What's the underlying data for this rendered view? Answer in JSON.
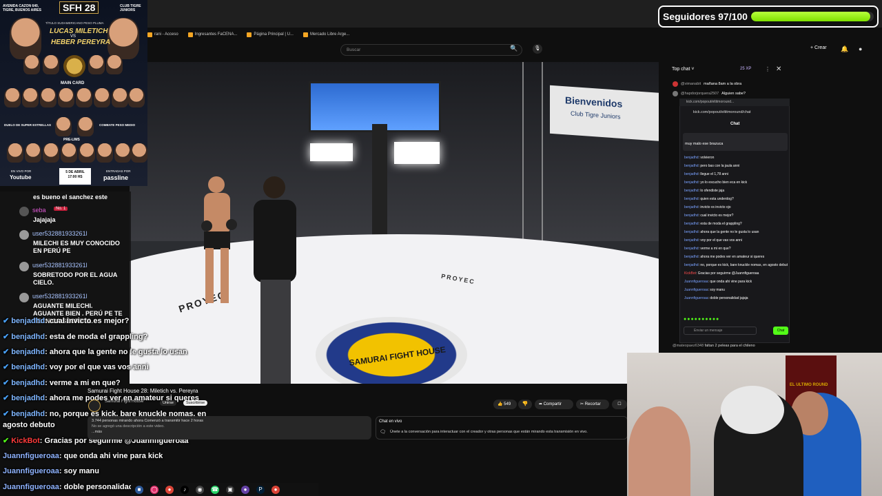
{
  "bookmarks": [
    "rani - Acceso",
    "Ingresantes FaCENA...",
    "Página Principal | U...",
    "Mercado Libre Arge..."
  ],
  "yt_header": {
    "search_placeholder": "Buscar",
    "create_label": "Crear"
  },
  "video": {
    "banner_title": "Bienvenidos",
    "banner_subtitle": "Club Tigre Juniors",
    "floor_brand_right": "PROYEC",
    "floor_brand_left": "PROYEC",
    "center_logo": "SAMURAI FIGHT HOUSE"
  },
  "poster": {
    "left_text": "AVENIDA CAZON 640, TIGRE, BUENOS AIRES",
    "right_text": "CLUB TIGRE JUNIORS",
    "event": "SFH 28",
    "title_line": "TÍTULO SUDAMERICANO PESO PLUMA",
    "fighter1": "LUCAS MILETICH",
    "vs": "VS",
    "fighter2": "HEBER PEREYRA",
    "main_card": "MAIN CARD",
    "duelo": "DUELO DE SUPER ESTRELLAS",
    "combate": "COMBATE PESO MEDIO",
    "prelims": "PRE-LIMS",
    "en_vivo": "EN VIVO POR",
    "youtube": "Youtube",
    "date": "5 DE ABRIL",
    "time": "17:00 HS",
    "entradas": "ENTRADAS POR",
    "passline": "passline"
  },
  "left_chat": [
    {
      "name": "",
      "msg": "es bueno el sanchez este"
    },
    {
      "name": "seba",
      "badge": "No. 1",
      "msg": "Jajajaja"
    },
    {
      "name": "user532881933261l",
      "msg": "MILECHI ES MUY CONOCIDO EN PERÚ PE"
    },
    {
      "name": "user532881933261l",
      "msg": "SOBRETODO POR EL AGUA CIELO."
    },
    {
      "name": "user532881933261l",
      "msg": "AGUANTE MILECHI. AGUANTE BIEN . PERÚ PE TE TECNICA SECRETA."
    }
  ],
  "overlay_chat": [
    {
      "user": "benjadhd",
      "text": "cual invicto es mejor?"
    },
    {
      "user": "benjadhd",
      "text": "esta de moda el grappling?"
    },
    {
      "user": "benjadhd",
      "text": "ahora que la gente no le gusta lo usan"
    },
    {
      "user": "benjadhd",
      "text": "voy por el que vas vos anni"
    },
    {
      "user": "benjadhd",
      "text": "verme a mi en que?"
    },
    {
      "user": "benjadhd",
      "text": "ahora me podes ver en amateur si queres"
    },
    {
      "user": "benjadhd",
      "text": "no, porque es kick, bare knuckle nomas, en"
    },
    {
      "user": "",
      "text": "agosto debuto"
    },
    {
      "user": "KickBot",
      "text": "Gracias por seguirme @Juannfigueroaa"
    },
    {
      "user": "Juannfigueroaa",
      "text": "que onda ahi vine para kick"
    },
    {
      "user": "Juannfigueroaa",
      "text": "soy manu"
    },
    {
      "user": "Juannfigueroaa",
      "text": "doble personalidad jajaja"
    }
  ],
  "video_info": {
    "title": "Samurai Fight House 28: Miletich vs. Pereyra",
    "channel": "Samurai Fight House",
    "join_label": "Unirse",
    "subscribe_label": "Suscribirse",
    "likes": "549",
    "share_label": "Compartir",
    "clip_label": "Recortar",
    "desc_line1": "3.744 personas mirando ahora  Comenzó a transmitir hace 2 horas",
    "desc_line2": "No se agregó una descripción a este video.",
    "desc_more": "...más",
    "live_chat_title": "Chat en vivo",
    "live_chat_desc": "Únete a la conversación para interactuar con el creador y otras personas que están mirando esta transmisión en vivo."
  },
  "yt_chat": {
    "header": "Top chat",
    "xp": "25 XP",
    "messages": [
      {
        "name": "@vimanabit",
        "text": "mañana 8am a la obra"
      },
      {
        "name": "@hapdorjorquera2507",
        "text": "Alguien sabe?"
      }
    ],
    "bottom_name": "@mateopaez6348",
    "bottom_text": "faltan 2 peleas para el chileno"
  },
  "kick": {
    "url_small": "kick.com/popout/eltitmoround...",
    "url": "kick.com/popout/eltitmoround/chat",
    "chat_header": "Chat",
    "pinned_msg": "muy malo ese brazuca",
    "messages": [
      {
        "user": "benjadhd",
        "text": "volvieron"
      },
      {
        "user": "benjadhd",
        "text": "pero bas con la jaula anni"
      },
      {
        "user": "benjadhd",
        "text": "llegue el 1,78 anni"
      },
      {
        "user": "benjadhd",
        "text": "yo lo escucho bien eca en kick"
      },
      {
        "user": "benjadhd",
        "text": "lo ofendiste jaja"
      },
      {
        "user": "benjadhd",
        "text": "quien esta underdog?"
      },
      {
        "user": "benjadhd",
        "text": "invicto vs invicto ojo"
      },
      {
        "user": "benjadhd",
        "text": "cual invicto es mejor?"
      },
      {
        "user": "benjadhd",
        "text": "esta de moda el grappling?"
      },
      {
        "user": "benjadhd",
        "text": "ahora que la gente no le gusta lo usan"
      },
      {
        "user": "benjadhd",
        "text": "voy por el que vas vos anni"
      },
      {
        "user": "benjadhd",
        "text": "verme a mi en que?"
      },
      {
        "user": "benjadhd",
        "text": "ahora me podes ver en amateur si queres"
      },
      {
        "user": "benjadhd",
        "text": "no, porque es kick, bare knuckle nomas, en agosto debuto"
      },
      {
        "user": "KickBot",
        "text": "Gracias por seguirme @Juannfigueroaa"
      },
      {
        "user": "Juannfigueroaa",
        "text": "que onda ahi vine para kick"
      },
      {
        "user": "Juannfigueroaa",
        "text": "soy manu"
      },
      {
        "user": "Juannfigueroaa",
        "text": "doble personalidad jajaja"
      }
    ],
    "input_placeholder": "Enviar un mensaje",
    "send_label": "Chat"
  },
  "followers": {
    "label": "Seguidores 97/100",
    "progress": 0.97
  },
  "webcam": {
    "banner_text": "EL ULTIMO ROUND"
  },
  "colors": {
    "kick_green": "#53fc18",
    "progress_green": "#b7ff3c",
    "yt_bg": "#0f0f0f"
  }
}
